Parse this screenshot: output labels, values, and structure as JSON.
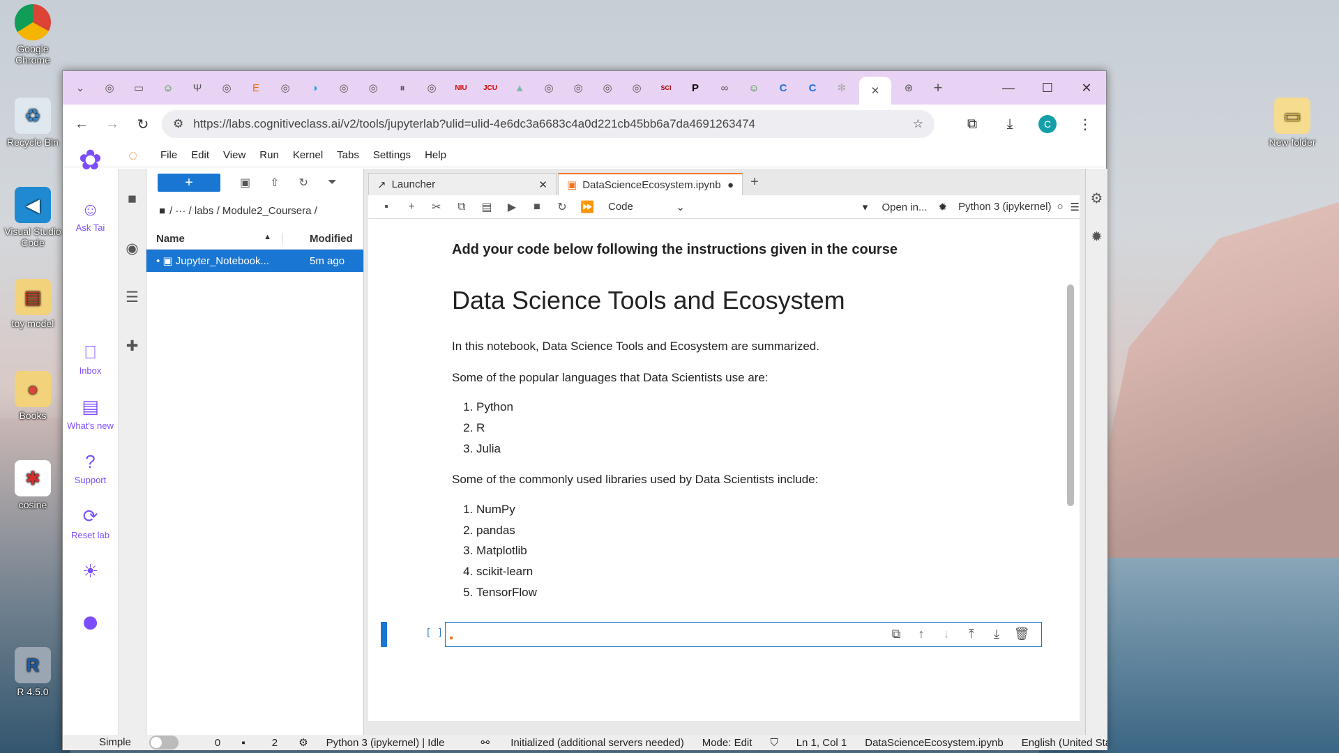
{
  "desktop": {
    "icons": [
      {
        "label": "Google Chrome",
        "glyph": "●"
      },
      {
        "label": "Recycle Bin",
        "glyph": "♻"
      },
      {
        "label": "Visual Studio Code",
        "glyph": "◀"
      },
      {
        "label": "toy model",
        "glyph": "▤"
      },
      {
        "label": "Books",
        "glyph": "●"
      },
      {
        "label": "cosine",
        "glyph": "✱"
      },
      {
        "label": "R 4.5.0",
        "glyph": "R"
      },
      {
        "label": "New folder",
        "glyph": "▭"
      }
    ]
  },
  "browser": {
    "tabs": [
      "◎",
      "▭",
      "☺",
      "Ψ",
      "◎",
      "E",
      "◎",
      "◑",
      "◎",
      "◎",
      "⏸",
      "◎",
      "NIU",
      "JCU",
      "▲",
      "◎",
      "◎",
      "◎",
      "◎",
      "SCI",
      "P",
      "∞",
      "☺",
      "C",
      "C",
      "✻",
      "✕",
      "⊛"
    ],
    "new_tab": "+",
    "window_controls": {
      "min": "—",
      "max": "☐",
      "close": "✕"
    },
    "url": "https://labs.cognitiveclass.ai/v2/tools/jupyterlab?ulid=ulid-4e6dc3a6683c4a0d221cb45bb6a7da4691263474",
    "profile_initial": "C"
  },
  "menu": [
    "File",
    "Edit",
    "View",
    "Run",
    "Kernel",
    "Tabs",
    "Settings",
    "Help"
  ],
  "rail": {
    "ask_tai": "Ask Tai",
    "inbox": "Inbox",
    "whats_new": "What's new",
    "support": "Support",
    "reset_lab": "Reset lab"
  },
  "filebrowser": {
    "new_label": "+",
    "breadcrumb": "/   ···   / labs / Module2_Coursera /",
    "col_name": "Name",
    "col_modified": "Modified",
    "files": [
      {
        "name": "Jupyter_Notebook...",
        "modified": "5m ago"
      }
    ]
  },
  "doc_tabs": {
    "launcher": "Launcher",
    "notebook": "DataScienceEcosystem.ipynb"
  },
  "nb_toolbar": {
    "cell_type": "Code",
    "open_in": "Open in...",
    "kernel": "Python 3 (ipykernel)"
  },
  "notebook": {
    "instruction": "Add your code below following the instructions given in the course",
    "title": "Data Science Tools and Ecosystem",
    "intro": "In this notebook, Data Science Tools and Ecosystem are summarized.",
    "languages_intro": "Some of the popular languages that Data Scientists use are:",
    "languages": [
      "Python",
      "R",
      "Julia"
    ],
    "libraries_intro": "Some of the commonly used libraries used by Data Scientists include:",
    "libraries": [
      "NumPy",
      "pandas",
      "Matplotlib",
      "scikit-learn",
      "TensorFlow"
    ],
    "prompt": "[ ]:"
  },
  "statusbar": {
    "mode_label": "Simple",
    "terminals": "0",
    "kernels": "2",
    "kernel_status": "Python 3 (ipykernel) | Idle",
    "lsp": "Initialized (additional servers needed)",
    "mode": "Mode: Edit",
    "position": "Ln 1, Col 1",
    "file": "DataScienceEcosystem.ipynb",
    "language": "English (United States)"
  }
}
